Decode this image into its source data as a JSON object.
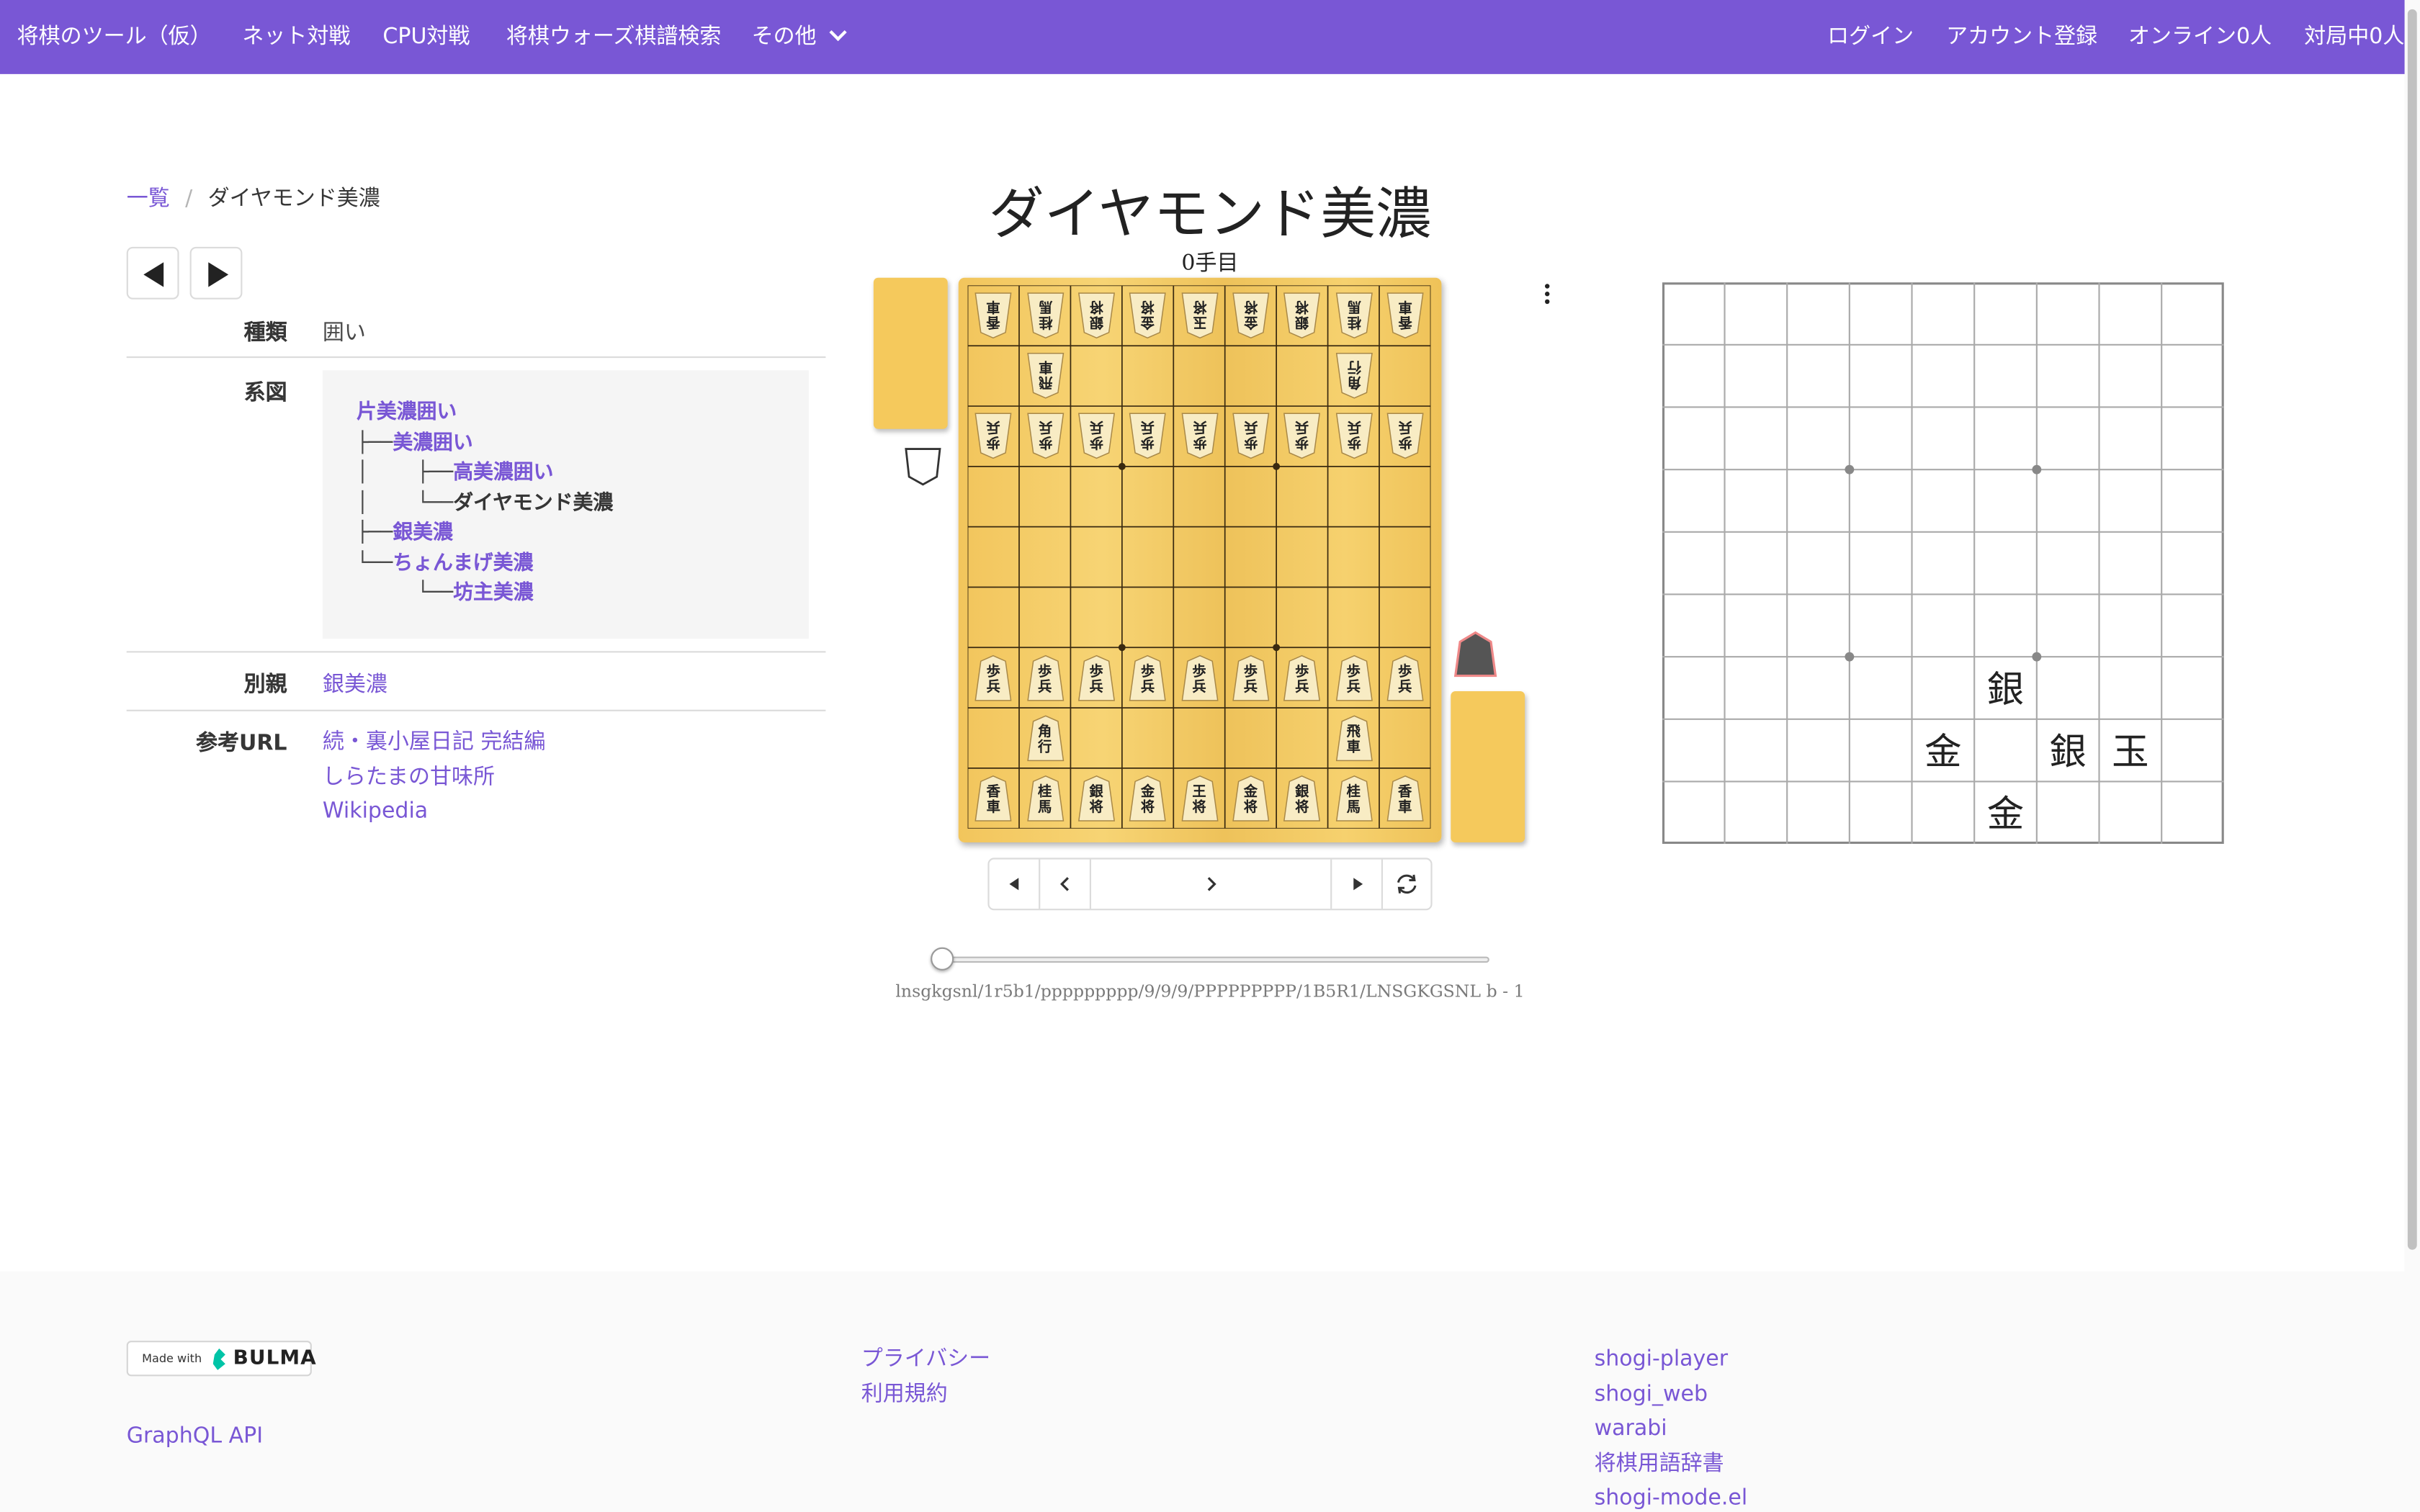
{
  "navbar": {
    "brand": "将棋のツール（仮）",
    "items": [
      "ネット対戦",
      "CPU対戦",
      "将棋ウォーズ棋譜検索",
      "その他"
    ],
    "right": [
      "ログイン",
      "アカウント登録",
      "オンライン0人",
      "対局中0人"
    ]
  },
  "breadcrumb": {
    "parent": "一覧",
    "separator": "/",
    "current": "ダイヤモンド美濃"
  },
  "info": {
    "kind_label": "種類",
    "kind_value": "囲い",
    "tree_label": "系図",
    "tree": [
      {
        "prefix": "",
        "name": "片美濃囲い"
      },
      {
        "prefix": "├──",
        "name": "美濃囲い"
      },
      {
        "prefix": "│    ├──",
        "name": "高美濃囲い"
      },
      {
        "prefix": "│    └──",
        "name": "ダイヤモンド美濃",
        "current": true
      },
      {
        "prefix": "├──",
        "name": "銀美濃"
      },
      {
        "prefix": "└──",
        "name": "ちょんまげ美濃"
      },
      {
        "prefix": "     └──",
        "name": "坊主美濃"
      }
    ],
    "alias_label": "別親",
    "alias_value": "銀美濃",
    "ref_label": "参考URL",
    "refs": [
      "続・裏小屋日記 完結編",
      "しらたまの甘味所",
      "Wikipedia"
    ]
  },
  "viewer": {
    "title": "ダイヤモンド美濃",
    "turn": "0手目",
    "sfen": "lnsgkgsnl/1r5b1/ppppppppp/9/9/9/PPPPPPPPP/1B5R1/LNSGKGSNL b - 1",
    "controls": [
      "first",
      "prev",
      "next",
      "next-one",
      "last",
      "flip"
    ],
    "slider_position": 0
  },
  "board_pieces": {
    "white_back": [
      "香車",
      "桂馬",
      "銀将",
      "金将",
      "玉将",
      "金将",
      "銀将",
      "桂馬",
      "香車"
    ],
    "white_rook": "飛車",
    "white_bishop": "角行",
    "pawn": "歩兵",
    "black_back": [
      "香車",
      "桂馬",
      "銀将",
      "金将",
      "王将",
      "金将",
      "銀将",
      "桂馬",
      "香車"
    ],
    "black_bishop": "角行",
    "black_rook": "飛車"
  },
  "castle_board": {
    "pieces": [
      {
        "file": 4,
        "rank": 7,
        "label": "銀"
      },
      {
        "file": 5,
        "rank": 8,
        "label": "金"
      },
      {
        "file": 3,
        "rank": 8,
        "label": "銀"
      },
      {
        "file": 2,
        "rank": 8,
        "label": "玉"
      },
      {
        "file": 4,
        "rank": 9,
        "label": "金"
      }
    ]
  },
  "footer": {
    "badge_made": "Made with",
    "badge_brand": "BULMA",
    "api_link": "GraphQL API",
    "middle": [
      "プライバシー",
      "利用規約"
    ],
    "right": [
      "shogi-player",
      "shogi_web",
      "warabi",
      "将棋用語辞書",
      "shogi-mode.el"
    ]
  },
  "colors": {
    "brand": "#7957d5",
    "board": "#f2c55c"
  }
}
